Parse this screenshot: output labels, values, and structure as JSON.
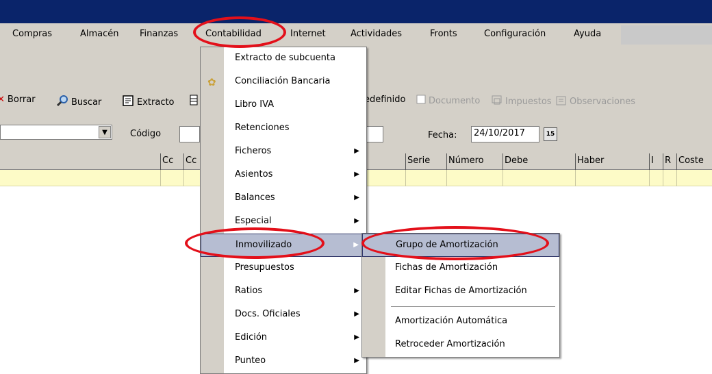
{
  "menubar": {
    "items": [
      "Compras",
      "Almacén",
      "Finanzas",
      "Contabilidad",
      "Internet",
      "Actividades",
      "Fronts",
      "Configuración",
      "Ayuda"
    ]
  },
  "toolbar": {
    "borrar": "Borrar",
    "buscar": "Buscar",
    "extracto": "Extracto",
    "predefinido": "edefinido",
    "documento": "Documento",
    "impuestos": "Impuestos",
    "observaciones": "Observaciones"
  },
  "filters": {
    "codigo_label": "Código",
    "fecha_label": "Fecha:",
    "fecha_value": "24/10/2017",
    "calendar_label": "15"
  },
  "grid": {
    "headers": [
      "Cc",
      "Cc",
      "Serie",
      "Número",
      "Debe",
      "Haber",
      "I",
      "R",
      "Coste"
    ]
  },
  "contabilidad_menu": {
    "items": [
      {
        "label": "Extracto de subcuenta",
        "submenu": false
      },
      {
        "label": "Conciliación Bancaria",
        "submenu": false
      },
      {
        "label": "Libro IVA",
        "submenu": false
      },
      {
        "label": "Retenciones",
        "submenu": false
      },
      {
        "label": "Ficheros",
        "submenu": true
      },
      {
        "label": "Asientos",
        "submenu": true
      },
      {
        "label": "Balances",
        "submenu": true
      },
      {
        "label": "Especial",
        "submenu": true
      },
      {
        "label": "Inmovilizado",
        "submenu": true
      },
      {
        "label": "Presupuestos",
        "submenu": false
      },
      {
        "label": "Ratios",
        "submenu": true
      },
      {
        "label": "Docs. Oficiales",
        "submenu": true
      },
      {
        "label": "Edición",
        "submenu": true
      },
      {
        "label": "Punteo",
        "submenu": true
      }
    ]
  },
  "inmovilizado_submenu": {
    "items": [
      "Grupo de Amortización",
      "Fichas de Amortización",
      "Editar Fichas de Amortización",
      "Amortización Automática",
      "Retroceder Amortización"
    ]
  },
  "colors": {
    "title_bar": "#0a246a",
    "highlight": "#b6bdd2",
    "annotation": "#e3101a",
    "grid_row": "#fdfbc7"
  },
  "icons": {
    "submenu_arrow": "▶",
    "combo_arrow": "▼",
    "conciliacion": "gear-icon"
  }
}
